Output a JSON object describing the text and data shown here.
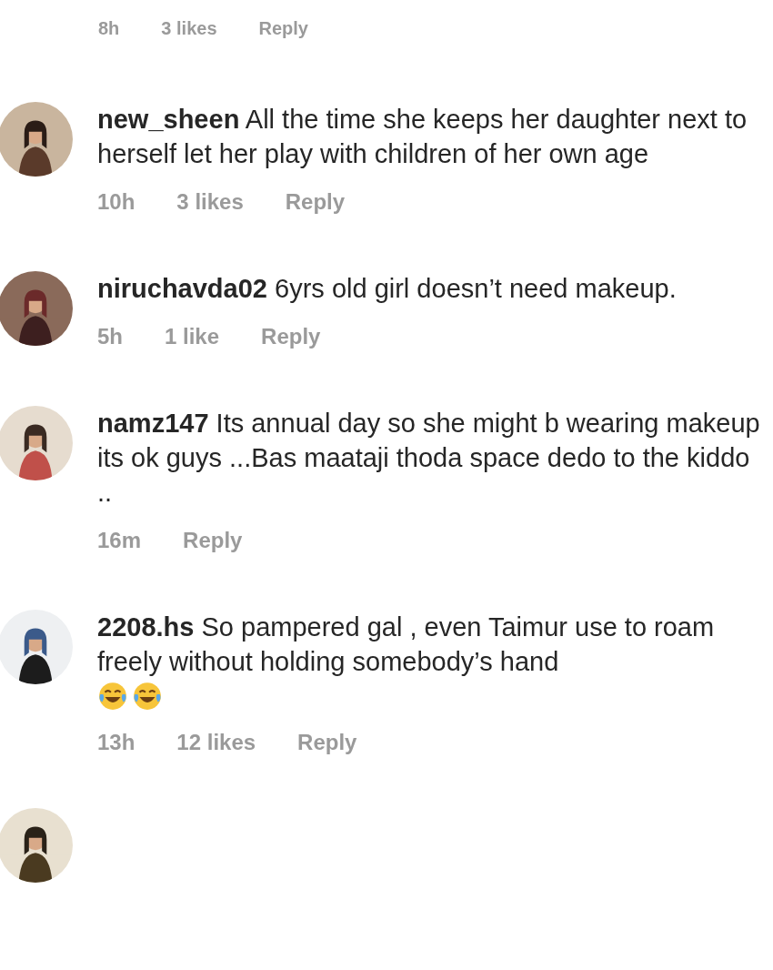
{
  "top_meta": {
    "time": "8h",
    "likes": "3 likes",
    "reply": "Reply"
  },
  "comments": [
    {
      "username": "new_sheen",
      "text": "All the time she keeps her daughter next to herself let her play with children of her own age",
      "time": "10h",
      "likes": "3 likes",
      "reply": "Reply"
    },
    {
      "username": "niruchavda02",
      "text": "6yrs old girl doesn’t need makeup.",
      "time": "5h",
      "likes": "1 like",
      "reply": "Reply"
    },
    {
      "username": "namz147",
      "text": "Its annual day so she might b wearing makeup its ok guys ...Bas maataji thoda space dedo to the kiddo ..",
      "time": "16m",
      "reply": "Reply"
    },
    {
      "username": "2208.hs",
      "text": "So pampered gal , even Taimur use to roam freely without holding somebody’s hand",
      "emojis": [
        {
          "kind": "tears-of-joy"
        },
        {
          "kind": "tears-of-joy"
        }
      ],
      "time": "13h",
      "likes": "12 likes",
      "reply": "Reply"
    }
  ]
}
